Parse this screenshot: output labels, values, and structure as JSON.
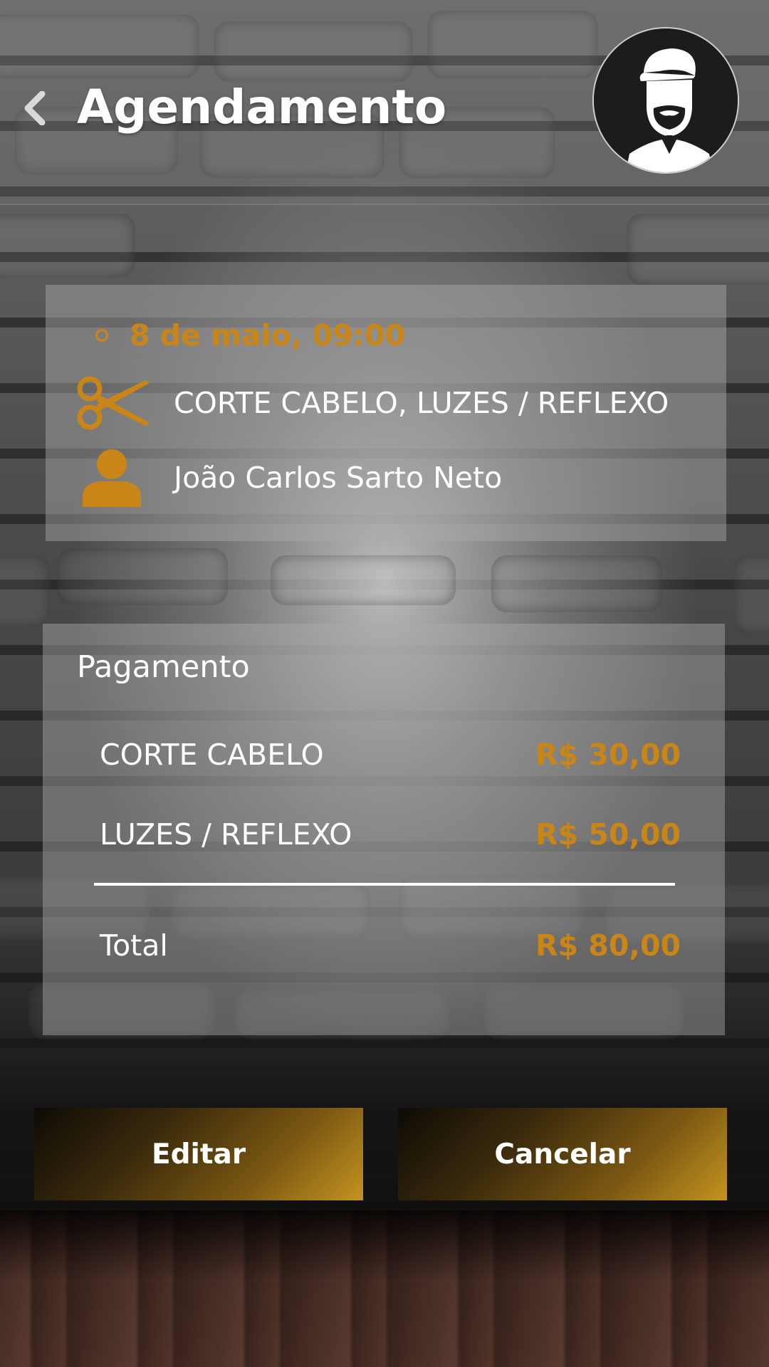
{
  "header": {
    "title": "Agendamento",
    "back_icon": "chevron-left-icon",
    "avatar_icon": "barber-avatar-icon"
  },
  "appointment": {
    "datetime": "8 de maio, 09:00",
    "services": "CORTE CABELO, LUZES / REFLEXO",
    "client": "João Carlos Sarto Neto",
    "service_icon": "scissors-icon",
    "client_icon": "person-icon"
  },
  "payment": {
    "title": "Pagamento",
    "items": [
      {
        "name": "CORTE CABELO",
        "price": "R$ 30,00"
      },
      {
        "name": "LUZES / REFLEXO",
        "price": "R$ 50,00"
      }
    ],
    "total_label": "Total",
    "total_value": "R$ 80,00"
  },
  "actions": {
    "edit_label": "Editar",
    "cancel_label": "Cancelar"
  },
  "colors": {
    "accent": "#c98616",
    "button_gradient_end": "#c4941e"
  }
}
